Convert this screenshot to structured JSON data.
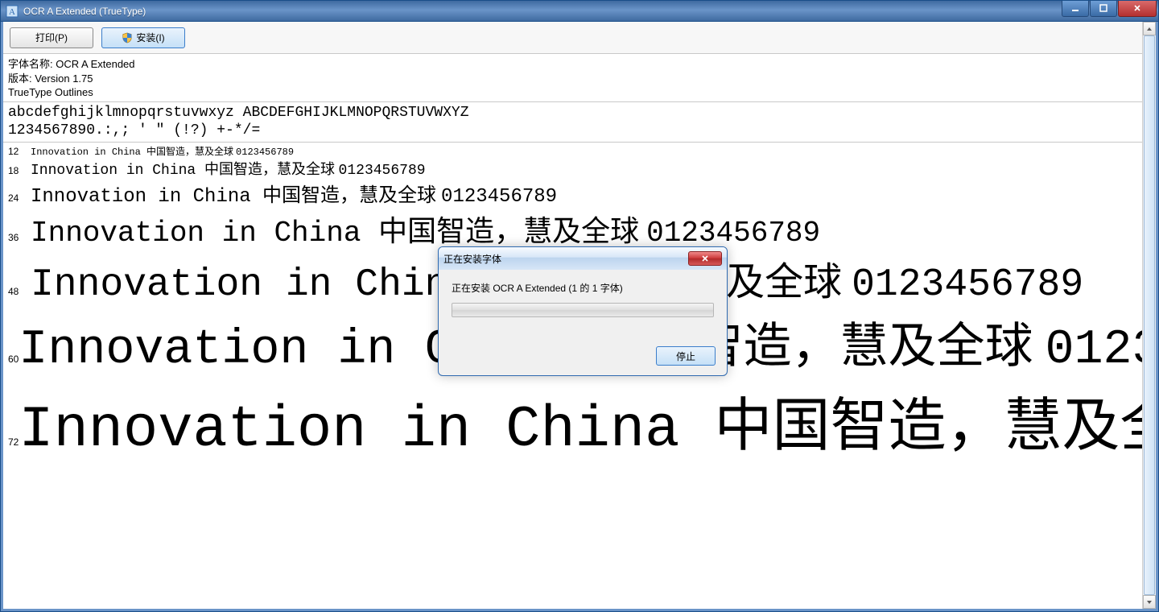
{
  "window": {
    "title": " OCR A Extended (TrueType)"
  },
  "toolbar": {
    "print_label": "打印(P)",
    "install_label": "安装(I)"
  },
  "meta": {
    "name_label": "字体名称: OCR A Extended",
    "version_label": "版本: Version 1.75",
    "outlines_label": "TrueType Outlines"
  },
  "glyphs": {
    "row1": "abcdefghijklmnopqrstuvwxyz ABCDEFGHIJKLMNOPQRSTUVWXYZ",
    "row2": "1234567890.:,; ' \" (!?) +-*/="
  },
  "sample_text_latin": "Innovation in China ",
  "sample_text_cjk": "中国智造，慧及全球 ",
  "sample_text_digits": "0123456789",
  "sample_sizes": [
    12,
    18,
    24,
    36,
    48,
    60,
    72
  ],
  "dialog": {
    "title": "正在安装字体",
    "message": "正在安装 OCR A Extended (1 的 1 字体)",
    "stop_label": "停止"
  }
}
